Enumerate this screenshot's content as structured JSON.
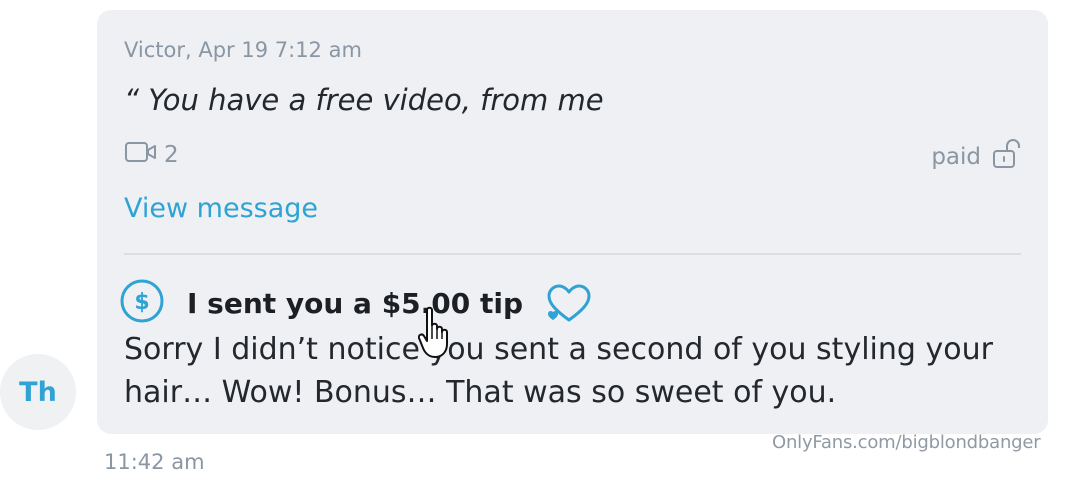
{
  "avatar": {
    "initials": "Th"
  },
  "quoted_message": {
    "meta": "Victor, Apr 19 7:12 am",
    "text": "“ You have a free video, from me",
    "media_count": "2",
    "media_icon": "video-icon",
    "paid_label": "paid",
    "paid_icon": "unlock-icon",
    "view_link": "View message"
  },
  "tip": {
    "icon": "dollar-circle-icon",
    "text": "I sent you a $5.00 tip",
    "heart_icon": "heart-outline-icon"
  },
  "message": {
    "text": "Sorry I didn’t notice you sent a second of you styling your hair… Wow! Bonus… That was so sweet of you."
  },
  "watermark": "OnlyFans.com/bigblondbanger",
  "timestamp": "11:42 am",
  "colors": {
    "accent": "#2ea3d4",
    "bubble": "#eef0f3",
    "muted": "#8a96a3",
    "text": "#24282d"
  }
}
